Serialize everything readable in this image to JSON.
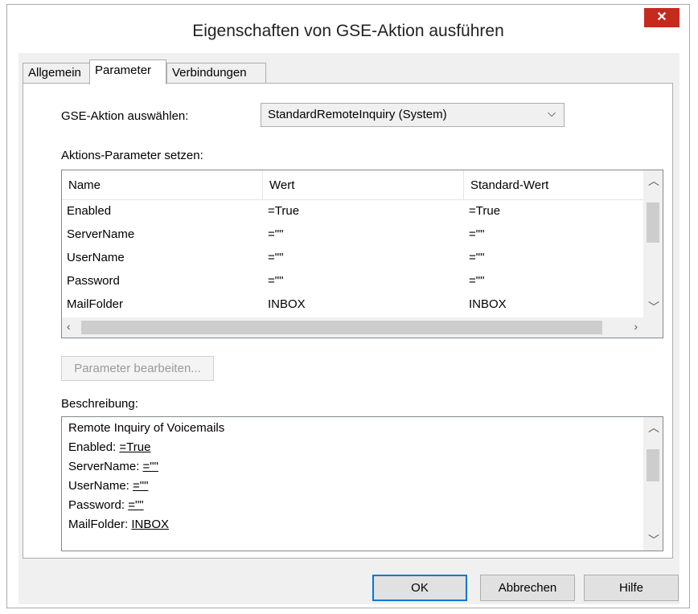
{
  "window": {
    "title": "Eigenschaften von GSE-Aktion ausführen",
    "close_glyph": "✕"
  },
  "tabs": [
    {
      "label": "Allgemein",
      "active": false
    },
    {
      "label": "Parameter",
      "active": true
    },
    {
      "label": "Verbindungen",
      "active": false
    }
  ],
  "gse": {
    "label": "GSE-Aktion auswählen:",
    "value": "StandardRemoteInquiry (System)",
    "arrow": "⌵"
  },
  "params": {
    "label": "Aktions-Parameter setzen:",
    "columns": [
      "Name",
      "Wert",
      "Standard-Wert"
    ],
    "rows": [
      [
        "Enabled",
        "=True",
        "=True"
      ],
      [
        "ServerName",
        "=\"\"",
        "=\"\""
      ],
      [
        "UserName",
        "=\"\"",
        "=\"\""
      ],
      [
        "Password",
        "=\"\"",
        "=\"\""
      ],
      [
        "MailFolder",
        "INBOX",
        "INBOX"
      ]
    ]
  },
  "edit_button": "Parameter bearbeiten...",
  "description": {
    "label": "Beschreibung:",
    "title": "Remote Inquiry of Voicemails",
    "lines": [
      {
        "key": "Enabled: ",
        "val": "=True"
      },
      {
        "key": "ServerName: ",
        "val": "=\"\""
      },
      {
        "key": "UserName: ",
        "val": "=\"\""
      },
      {
        "key": "Password: ",
        "val": "=\"\""
      },
      {
        "key": "MailFolder: ",
        "val": "INBOX"
      }
    ]
  },
  "buttons": {
    "ok": "OK",
    "cancel": "Abbrechen",
    "help": "Hilfe"
  },
  "colors": {
    "close": "#c42b1c",
    "default_border": "#0078d7"
  }
}
